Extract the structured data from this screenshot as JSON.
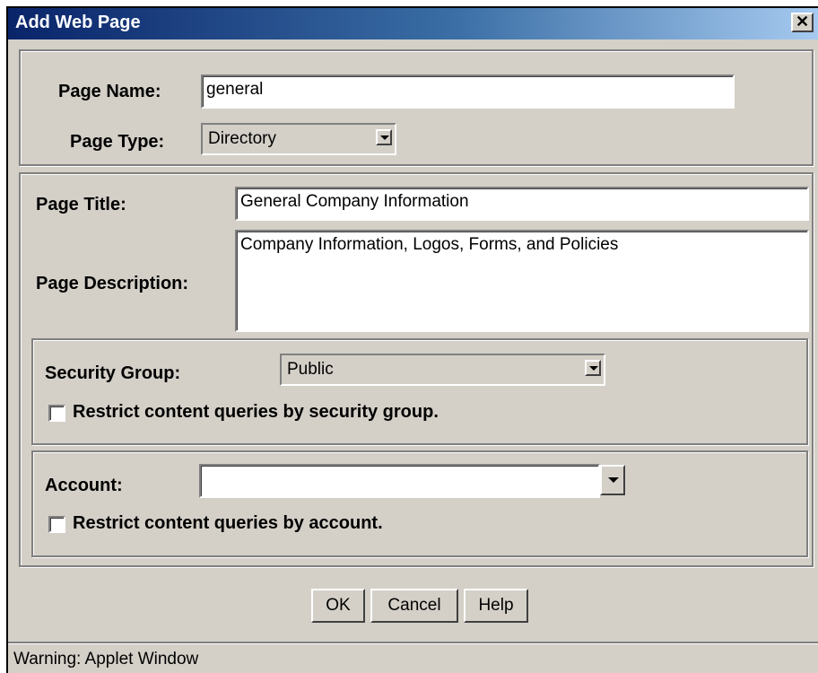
{
  "window": {
    "title": "Add Web Page",
    "close_glyph": "✕"
  },
  "page": {
    "name_label": "Page Name:",
    "name_value": "general",
    "type_label": "Page Type:",
    "type_value": "Directory"
  },
  "details": {
    "title_label": "Page Title:",
    "title_value": "General Company Information",
    "description_label": "Page Description:",
    "description_value": "Company Information, Logos, Forms, and Policies"
  },
  "security": {
    "group_label": "Security Group:",
    "group_value": "Public",
    "restrict_label": "Restrict content queries by security group.",
    "restrict_checked": false
  },
  "account": {
    "label": "Account:",
    "value": "",
    "restrict_label": "Restrict content queries by account.",
    "restrict_checked": false
  },
  "buttons": {
    "ok": "OK",
    "cancel": "Cancel",
    "help": "Help"
  },
  "status": {
    "text": "Warning: Applet Window"
  },
  "colors": {
    "titlebar_start": "#0a246a",
    "titlebar_end": "#a6caf0",
    "face": "#d4d0c8"
  }
}
